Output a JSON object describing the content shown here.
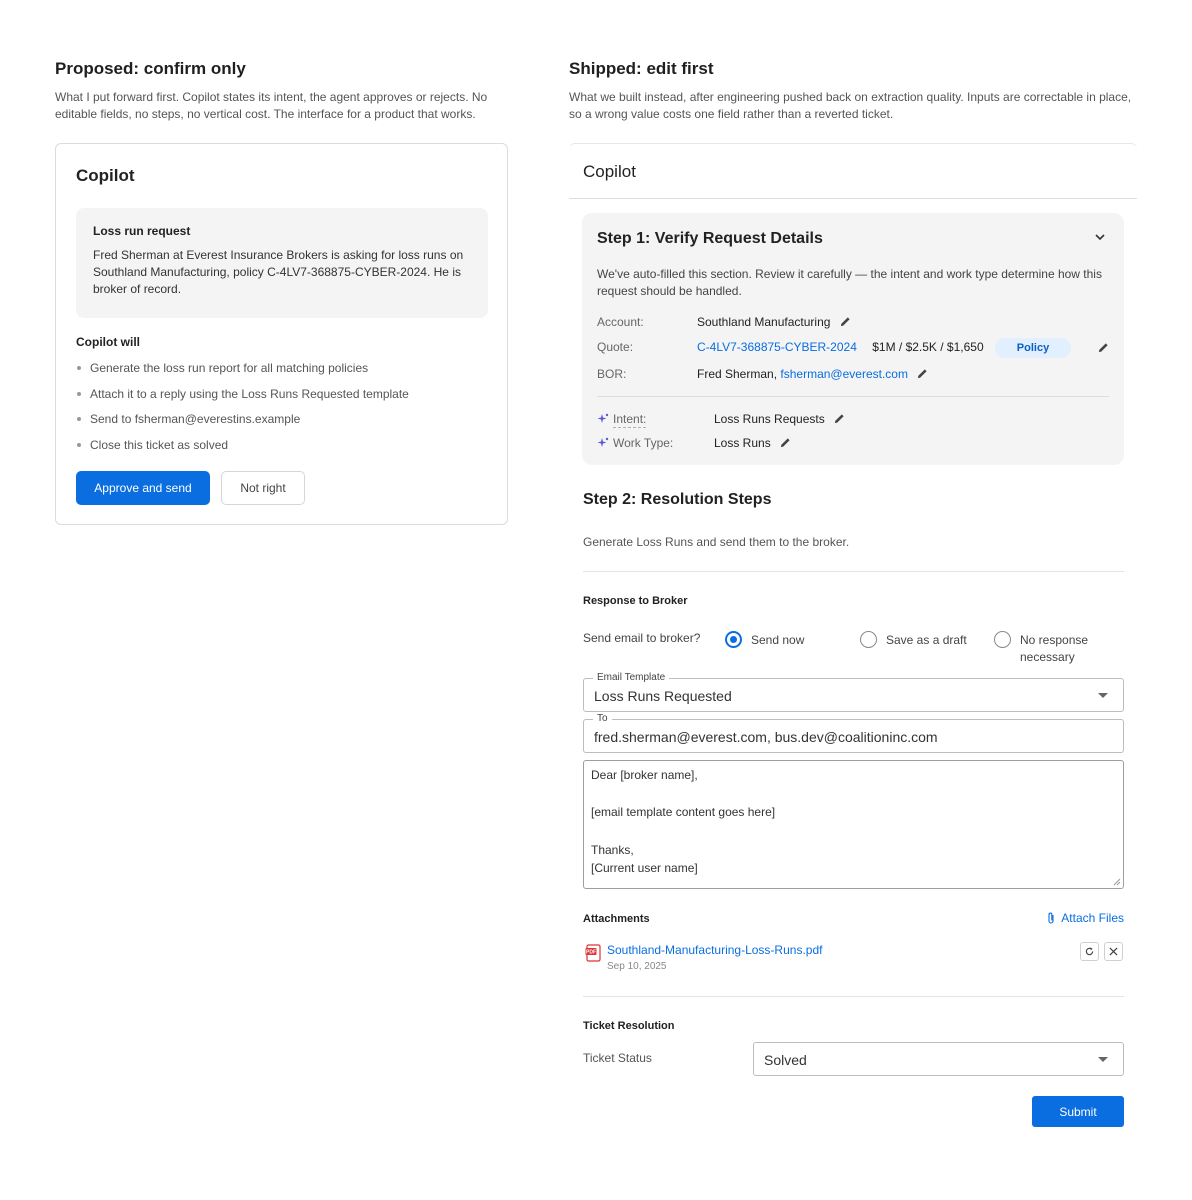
{
  "left": {
    "title": "Proposed: confirm only",
    "desc": "What I put forward first. Copilot states its intent, the agent approves or rejects. No editable fields, no steps, no vertical cost. The interface for a product that works.",
    "card_title": "Copilot",
    "request": {
      "title": "Loss run request",
      "body": "Fred Sherman at Everest Insurance Brokers is asking for loss runs on Southland Manufacturing, policy C-4LV7-368875-CYBER-2024. He is broker of record."
    },
    "will_title": "Copilot will",
    "will_items": [
      "Generate the loss run report for all matching policies",
      "Attach it to a reply using the Loss Runs Requested template",
      "Send to fsherman@everestins.example",
      "Close this ticket as solved"
    ],
    "approve_label": "Approve and send",
    "not_right_label": "Not right"
  },
  "right": {
    "title": "Shipped: edit first",
    "desc": "What we built instead, after engineering pushed back on extraction quality. Inputs are correctable in place, so a wrong value costs one field rather than a reverted ticket.",
    "panel_title": "Copilot",
    "step1": {
      "title": "Step 1: Verify Request Details",
      "desc": "We've auto-filled this section. Review it carefully — the intent and work type determine how this request should be handled.",
      "account_label": "Account:",
      "account_value": "Southland Manufacturing",
      "quote_label": "Quote:",
      "quote_link": "C-4LV7-368875-CYBER-2024",
      "quote_amounts": "$1M / $2.5K / $1,650",
      "quote_badge": "Policy",
      "bor_label": "BOR:",
      "bor_name": "Fred Sherman,",
      "bor_email": "fsherman@everest.com",
      "intent_label": "Intent:",
      "intent_value": "Loss Runs Requests",
      "worktype_label": "Work Type:",
      "worktype_value": "Loss Runs"
    },
    "step2": {
      "title": "Step 2: Resolution Steps",
      "desc": "Generate Loss Runs and send them to the broker."
    },
    "response": {
      "title": "Response to Broker",
      "send_question": "Send email to broker?",
      "options": [
        "Send now",
        "Save as a draft",
        "No response",
        "necessary"
      ],
      "template_legend": "Email Template",
      "template_value": "Loss Runs Requested",
      "to_legend": "To",
      "to_value": "fred.sherman@everest.com, bus.dev@coalitioninc.com",
      "body_lines": [
        "Dear [broker name],",
        "",
        "[email template content goes here]",
        "",
        "Thanks,",
        "[Current user name]"
      ]
    },
    "attachments": {
      "title": "Attachments",
      "attach_label": "Attach Files",
      "file_name": "Southland-Manufacturing-Loss-Runs.pdf",
      "file_date": "Sep 10, 2025"
    },
    "resolution": {
      "title": "Ticket Resolution",
      "status_label": "Ticket Status",
      "status_value": "Solved"
    },
    "submit_label": "Submit"
  },
  "colors": {
    "accent": "#0a6ee0",
    "panel_bg": "#f4f4f4",
    "pill_bg": "#e2efff"
  }
}
